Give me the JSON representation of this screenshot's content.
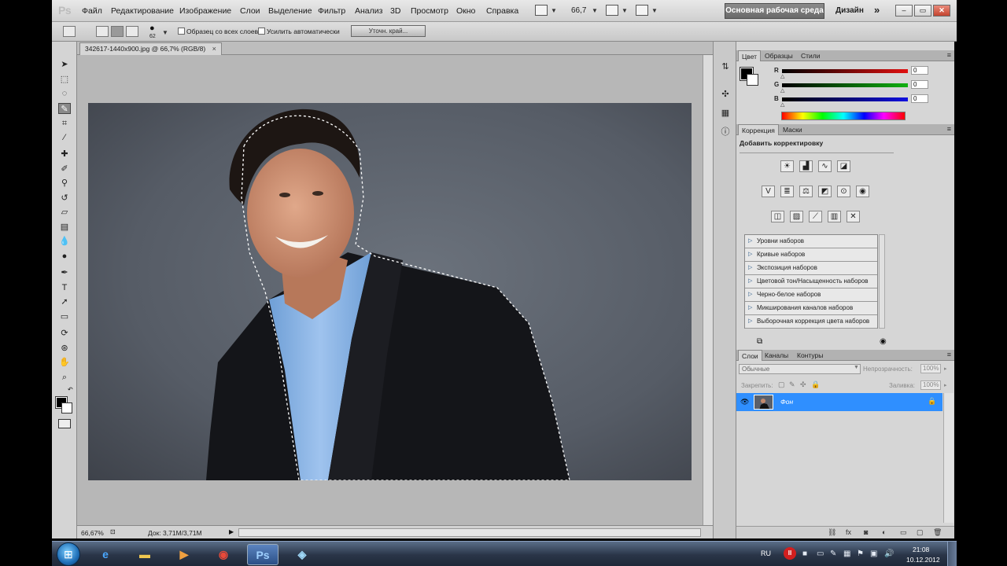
{
  "menubar": {
    "logo": "Ps",
    "items": [
      "Файл",
      "Редактирование",
      "Изображение",
      "Слои",
      "Выделение",
      "Фильтр",
      "Анализ",
      "3D",
      "Просмотр",
      "Окно",
      "Справка"
    ],
    "zoom": "66,7",
    "workspace": "Основная рабочая среда",
    "design": "Дизайн",
    "more": "»"
  },
  "options": {
    "brush_size": "62",
    "sample_all_layers": "Образец со всех слоев",
    "auto_enhance": "Усилить автоматически",
    "refine_edge": "Уточн. край..."
  },
  "document": {
    "tab_title": "342617-1440x900.jpg @ 66,7% (RGB/8)",
    "tab_close": "×",
    "zoom_status": "66,67%",
    "doc_info": "Док: 3,71M/3,71M"
  },
  "color_panel": {
    "tabs": [
      "Цвет",
      "Образцы",
      "Стили"
    ],
    "channels": [
      {
        "label": "R",
        "value": "0",
        "color": "#e01010"
      },
      {
        "label": "G",
        "value": "0",
        "color": "#10b010"
      },
      {
        "label": "B",
        "value": "0",
        "color": "#1010e0"
      }
    ]
  },
  "adjustments": {
    "tabs": [
      "Коррекция",
      "Маски"
    ],
    "title": "Добавить корректировку",
    "presets": [
      "Уровни наборов",
      "Кривые наборов",
      "Экспозиция наборов",
      "Цветовой тон/Насыщенность наборов",
      "Черно-белое наборов",
      "Микширования каналов наборов",
      "Выборочная коррекция цвета наборов"
    ]
  },
  "layers": {
    "tabs": [
      "Слои",
      "Каналы",
      "Контуры"
    ],
    "blend_mode": "Обычные",
    "opacity_label": "Непрозрачность:",
    "opacity": "100%",
    "lock_label": "Закрепить:",
    "fill_label": "Заливка:",
    "fill": "100%",
    "layer_name": "Фон"
  },
  "taskbar": {
    "lang": "RU",
    "time": "21:08",
    "date": "10.12.2012",
    "ps_label": "Ps"
  },
  "colors": {
    "accent": "#2f8fff",
    "canvas_bg": "#b7b7b7",
    "foreground": "#000000",
    "background": "#ffffff"
  }
}
